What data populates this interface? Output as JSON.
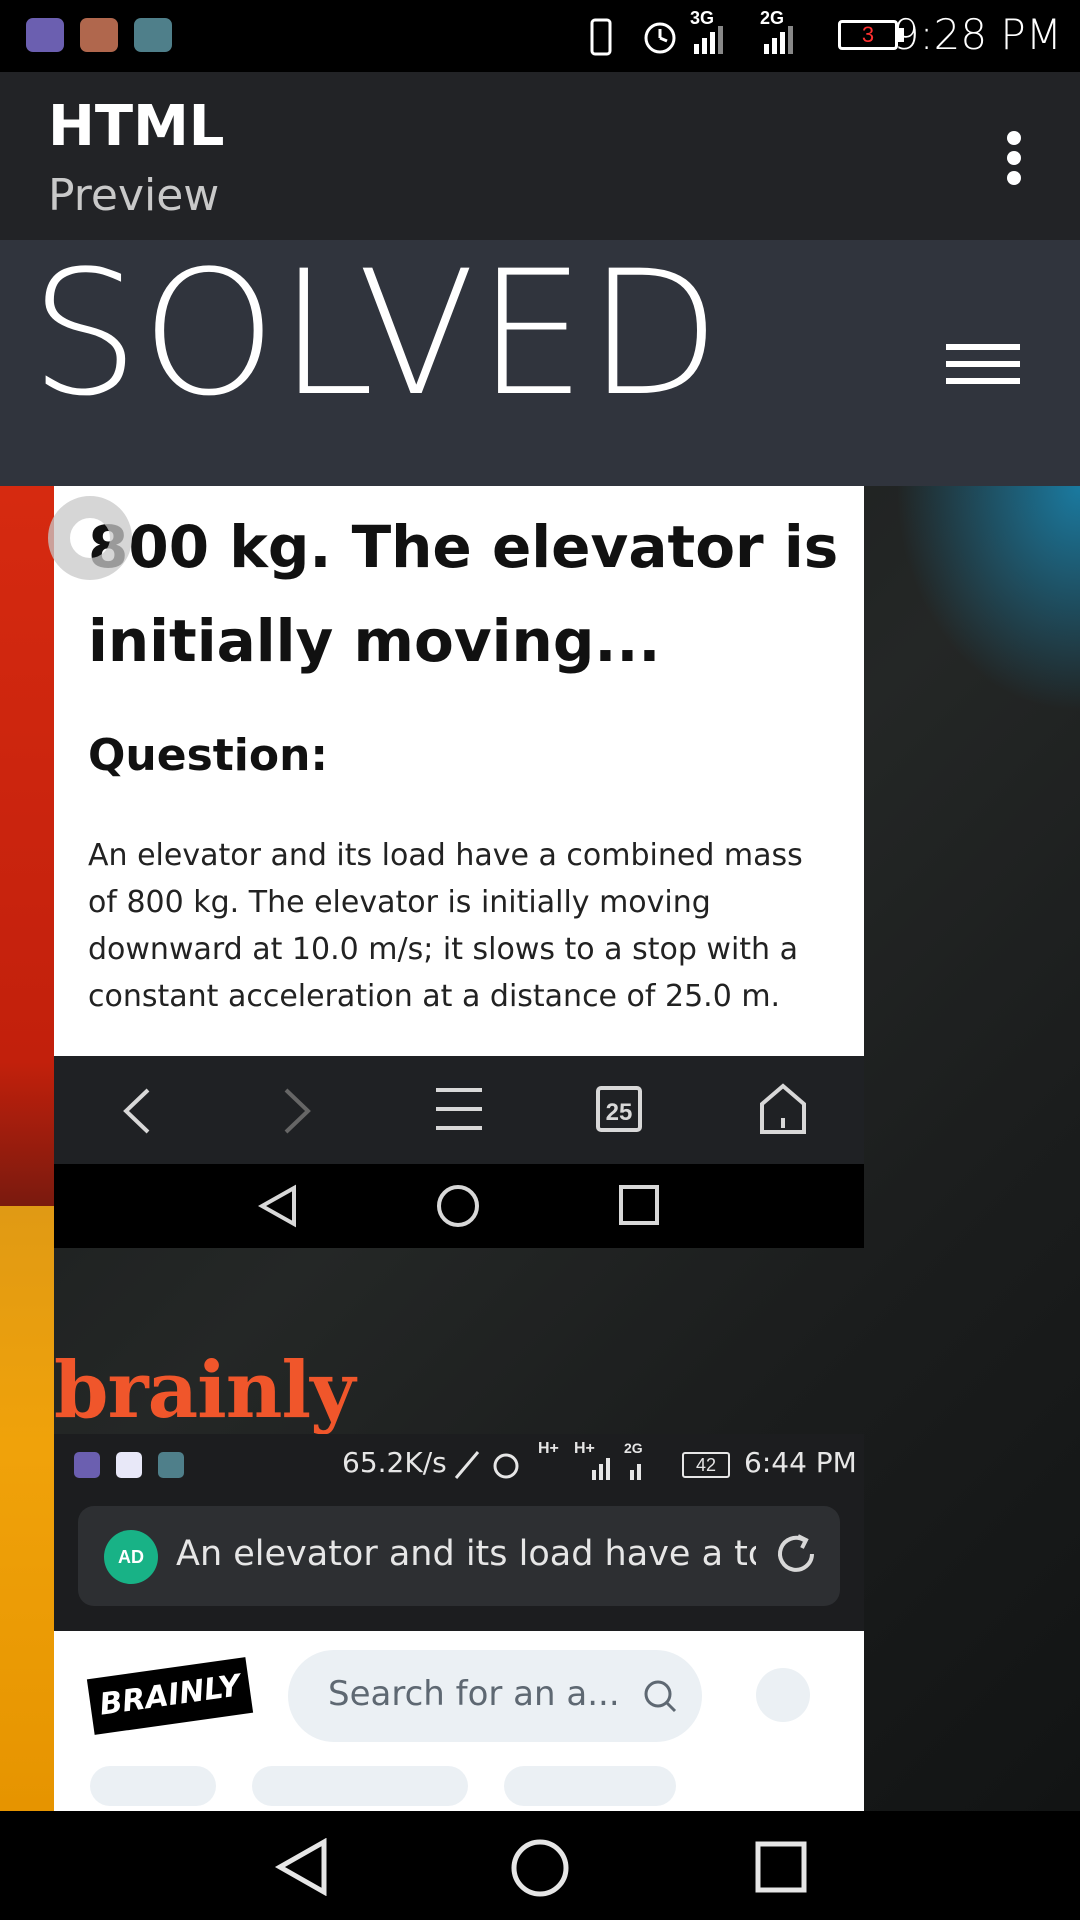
{
  "status_bar": {
    "time": "9:28 PM",
    "battery_level": "3",
    "network_1": "3G",
    "network_2": "2G",
    "icons": [
      "notification-app-icon",
      "clipboard-icon",
      "gallery-icon",
      "vibrate-icon",
      "alarm-icon",
      "signal-icon",
      "battery-icon"
    ]
  },
  "app_bar": {
    "title": "HTML",
    "subtitle": "Preview",
    "menu_icon": "more-vertical-icon"
  },
  "site_header": {
    "title": "SOLVED",
    "menu_icon": "hamburger-menu-icon"
  },
  "content": {
    "heading": "800 kg. The elevator is initially moving...",
    "question_label": "Question:",
    "question_text": "An elevator and its load have a combined mass of 800 kg. The elevator is initially moving downward at 10.0 m/s; it slows to a stop with a constant acceleration at a distance of 25.0 m."
  },
  "inner_browser_toolbar": {
    "tab_count": "25",
    "buttons": [
      "back-icon",
      "forward-icon",
      "menu-icon",
      "tabs-icon",
      "home-icon"
    ]
  },
  "brainly_banner": {
    "wordmark": "brainly"
  },
  "inner_status_bar": {
    "speed": "65.2K/s",
    "network_1": "H+",
    "network_2": "H+",
    "network_3": "2G",
    "battery_level": "42",
    "time": "6:44 PM"
  },
  "inner_url_bar": {
    "badge": "AD",
    "url_text": "An elevator and its load have a total m"
  },
  "brainly_page": {
    "logo": "BRAINLY",
    "search_placeholder": "Search for an a..."
  },
  "colors": {
    "app_bar": "#222326",
    "site_header": "#30343d",
    "brainly_orange": "#f0562b",
    "ad_badge": "#18b286"
  }
}
